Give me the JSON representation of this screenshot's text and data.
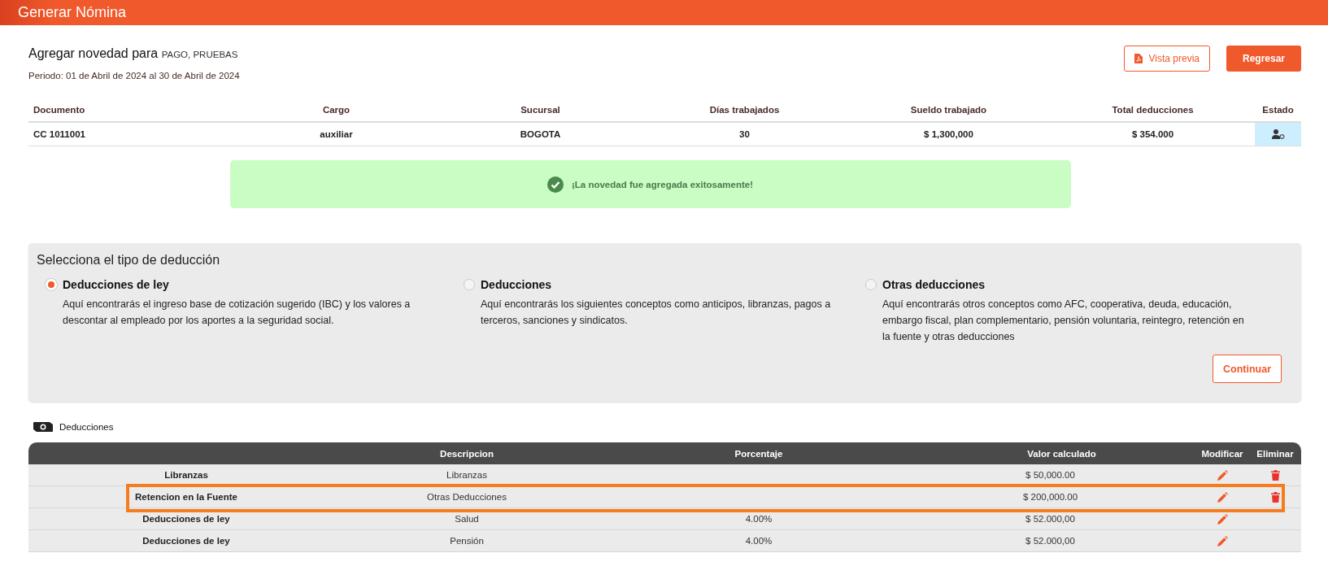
{
  "header": {
    "title": "Generar Nómina"
  },
  "page": {
    "title": "Agregar novedad para",
    "employee": "PAGO, PRUEBAS",
    "period": "Periodo: 01 de Abril de 2024 al 30 de Abril de 2024"
  },
  "buttons": {
    "preview": "Vista previa",
    "back": "Regresar"
  },
  "employee_table": {
    "columns": [
      "Documento",
      "Cargo",
      "Sucursal",
      "Días trabajados",
      "Sueldo trabajado",
      "Total deducciones",
      "Estado"
    ],
    "row": [
      "CC 1011001",
      "auxiliar",
      "BOGOTA",
      "30",
      "$ 1,300,000",
      "$ 354.000"
    ]
  },
  "alert": {
    "message": "¡La novedad fue agregada exitosamente!"
  },
  "deduction_type": {
    "title": "Selecciona el tipo de deducción",
    "options": [
      {
        "label": "Deducciones de ley",
        "description": "Aquí encontrarás el ingreso base de cotización sugerido (IBC) y los valores a descontar al empleado por los aportes a la seguridad social.",
        "selected": true
      },
      {
        "label": "Deducciones",
        "description": "Aquí encontrarás los siguientes conceptos como anticipos, libranzas, pagos a terceros, sanciones y sindicatos.",
        "selected": false
      },
      {
        "label": "Otras deducciones",
        "description": "Aquí encontrarás otros conceptos como AFC, cooperativa, deuda, educación, embargo fiscal, plan complementario, pensión voluntaria, reintegro, retención en la fuente y otras deducciones",
        "selected": false
      }
    ],
    "continue": "Continuar"
  },
  "deductions": {
    "title": "Deducciones",
    "columns": [
      "Descripcion",
      "Porcentaje",
      "Valor calculado",
      "Modificar",
      "Eliminar"
    ],
    "rows": [
      {
        "concept": "Libranzas",
        "description": "Libranzas",
        "percentage": "",
        "value": "$ 50,000.00",
        "deletable": true,
        "highlighted": false
      },
      {
        "concept": "Retencion en la Fuente",
        "description": "Otras Deducciones",
        "percentage": "",
        "value": "$ 200,000.00",
        "deletable": true,
        "highlighted": true
      },
      {
        "concept": "Deducciones de ley",
        "description": "Salud",
        "percentage": "4.00%",
        "value": "$ 52.000,00",
        "deletable": false,
        "highlighted": false
      },
      {
        "concept": "Deducciones de ley",
        "description": "Pensión",
        "percentage": "4.00%",
        "value": "$ 52.000,00",
        "deletable": false,
        "highlighted": false
      }
    ]
  }
}
